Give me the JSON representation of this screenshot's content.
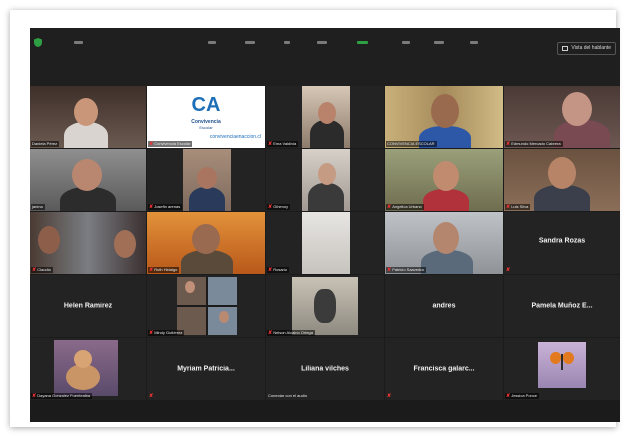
{
  "toolbar": {
    "view_label": "Vista del hablante",
    "icons": [
      "shield-icon",
      "signal-icon",
      "info-icon",
      "mic-icon",
      "video-icon",
      "participants-icon",
      "chat-icon",
      "share-icon",
      "record-icon",
      "reactions-icon"
    ]
  },
  "colors": {
    "background": "#1b1b1b",
    "tile": "#232323",
    "active_speaker": "#d9e13a",
    "muted": "#e33333"
  },
  "logo": {
    "brand": "CA",
    "line1": "Convivencia",
    "line2": "Escolar",
    "url_text": "convivenciaenaccion.cl"
  },
  "participants": [
    {
      "name": "Daniela Pérez",
      "type": "video",
      "muted": false
    },
    {
      "name": "Convivencia Escolar",
      "type": "logo",
      "muted": true
    },
    {
      "name": "Ema Valdivia",
      "type": "video",
      "muted": true
    },
    {
      "name": "CONVIVENCIA ESCOLAR",
      "type": "video",
      "muted": false,
      "active": true
    },
    {
      "name": "Edmundo Mercado Cabrera",
      "type": "video",
      "muted": true
    },
    {
      "name": "janina",
      "type": "video",
      "muted": false
    },
    {
      "name": "Josefin arenas",
      "type": "video",
      "muted": true
    },
    {
      "name": "Gihenoy",
      "type": "video",
      "muted": true
    },
    {
      "name": "Angelica Urbano",
      "type": "video",
      "muted": true
    },
    {
      "name": "Luis Silva",
      "type": "video",
      "muted": true
    },
    {
      "name": "Claudia",
      "type": "video",
      "muted": true
    },
    {
      "name": "Ruth Hidalgo",
      "type": "video",
      "muted": true
    },
    {
      "name": "Rosario",
      "type": "video",
      "muted": true
    },
    {
      "name": "Patricio Saavedra",
      "type": "video",
      "muted": true
    },
    {
      "name": "Sandra Rozas",
      "type": "name",
      "muted": true
    },
    {
      "name": "Helen Ramirez",
      "type": "name",
      "muted": false
    },
    {
      "name": "Mindy Gutiérrez",
      "type": "video",
      "muted": true
    },
    {
      "name": "Nelson Alcaino Ortega",
      "type": "video",
      "muted": true
    },
    {
      "name": "andres",
      "type": "name",
      "muted": false
    },
    {
      "name": "Pamela Muñoz E...",
      "type": "name",
      "muted": false
    },
    {
      "name": "Dayana Gonzalez Fuentealba",
      "type": "video",
      "muted": true
    },
    {
      "name": "Myriam Patricia...",
      "type": "name",
      "muted": true
    },
    {
      "name": "Liliana vilches",
      "type": "name",
      "muted": false,
      "caption": "Conectar con el audio"
    },
    {
      "name": "Francisca galarc...",
      "type": "name",
      "muted": true
    },
    {
      "name": "Jessica Ponce",
      "type": "video",
      "muted": true
    }
  ]
}
